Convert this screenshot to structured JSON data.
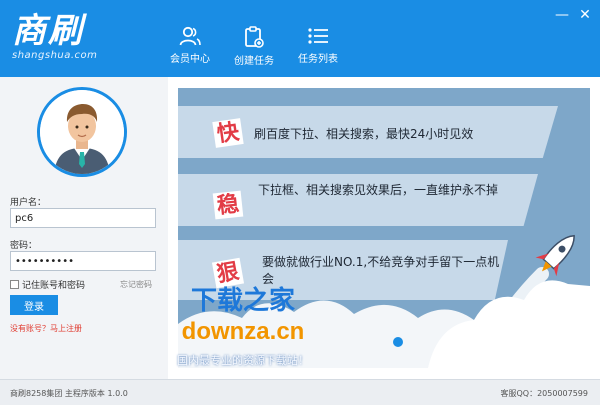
{
  "logo": {
    "main": "商刷",
    "sub": "shangshua.com"
  },
  "nav": {
    "member_label": "会员中心",
    "create_label": "创建任务",
    "list_label": "任务列表"
  },
  "window": {
    "minimize": "—",
    "close": "✕"
  },
  "login": {
    "username_label": "用户名：",
    "username_value": "pc6",
    "password_label": "密码：",
    "password_value": "••••••••••",
    "remember_label": "记住账号和密码",
    "forgot_label": "忘记密码",
    "login_button": "登录",
    "register_link": "没有账号？马上注册"
  },
  "banner": {
    "features": [
      {
        "char": "快",
        "text": "刷百度下拉、相关搜索，最快24小时见效"
      },
      {
        "char": "稳",
        "text": "下拉框、相关搜索见效果后，一直维护永不掉"
      },
      {
        "char": "狠",
        "text": "要做就做行业NO.1,不给竞争对手留下一点机会"
      }
    ]
  },
  "watermark": {
    "line1": "下载之家",
    "line2": "downza.cn",
    "line3": "国内最专业的资源下载站！"
  },
  "footer": {
    "version": "商刷8258集团 主程序版本 1.0.0",
    "qq": "客服QQ：2050007599"
  },
  "colors": {
    "header_bg": "#1a8de4",
    "accent_red": "#e23c46",
    "banner_bg": "#7ea7c9"
  }
}
